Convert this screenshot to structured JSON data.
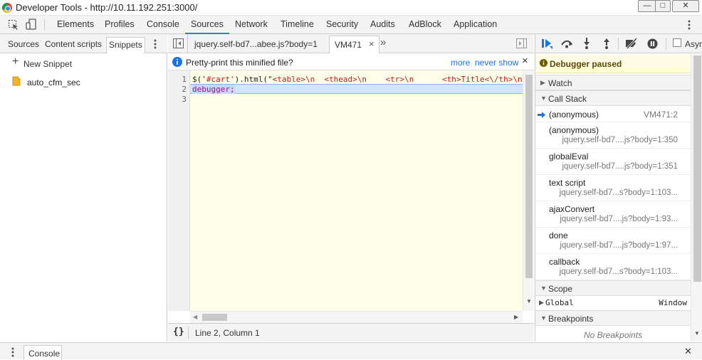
{
  "window": {
    "title": "Developer Tools - http://10.11.192.251:3000/",
    "minimize": "—",
    "maximize": "□",
    "close": "✕"
  },
  "main_tabs": [
    {
      "label": "Elements"
    },
    {
      "label": "Profiles"
    },
    {
      "label": "Console"
    },
    {
      "label": "Sources"
    },
    {
      "label": "Network"
    },
    {
      "label": "Timeline"
    },
    {
      "label": "Security"
    },
    {
      "label": "Audits"
    },
    {
      "label": "AdBlock"
    },
    {
      "label": "Application"
    }
  ],
  "left_panel": {
    "tabs": [
      {
        "label": "Sources"
      },
      {
        "label": "Content scripts"
      },
      {
        "label": "Snippets"
      }
    ],
    "new_snippet": "New Snippet",
    "files": [
      {
        "name": "auto_cfm_sec"
      }
    ]
  },
  "editor": {
    "tabs": [
      {
        "label": "jquery.self-bd7...abee.js?body=1"
      },
      {
        "label": "VM471"
      }
    ],
    "overflow": "»",
    "infobar": {
      "message": "Pretty-print this minified file?",
      "more": "more",
      "never_show": "never show",
      "close": "×"
    },
    "line_numbers": [
      "1",
      "2",
      "3"
    ],
    "line1": {
      "part1": "$(",
      "part2": "'#cart'",
      "part3": ").html(\"",
      "part4": "<table>\\n  <thead>\\n    <tr>\\n      <th>Title<\\/th>\\n"
    },
    "line2": "debugger;",
    "line3": "",
    "status": "Line 2, Column 1",
    "format_icon": "{}"
  },
  "debugger": {
    "paused_label": "Debugger paused",
    "async_label": "Async",
    "sections": {
      "watch": "Watch",
      "call_stack": "Call Stack",
      "scope": "Scope",
      "breakpoints": "Breakpoints"
    },
    "call_stack": [
      {
        "fn": "(anonymous)",
        "loc": "VM471:2"
      },
      {
        "fn": "(anonymous)",
        "loc": "jquery.self-bd7....js?body=1:350"
      },
      {
        "fn": "globalEval",
        "loc": "jquery.self-bd7....js?body=1:351"
      },
      {
        "fn": "text script",
        "loc": "jquery.self-bd7...s?body=1:103..."
      },
      {
        "fn": "ajaxConvert",
        "loc": "jquery.self-bd7....js?body=1:93..."
      },
      {
        "fn": "done",
        "loc": "jquery.self-bd7....js?body=1:97..."
      },
      {
        "fn": "callback",
        "loc": "jquery.self-bd7...s?body=1:103..."
      }
    ],
    "scope": {
      "name": "Global",
      "value": "Window"
    },
    "breakpoints_empty": "No Breakpoints"
  },
  "drawer": {
    "tab": "Console",
    "close": "✕"
  }
}
